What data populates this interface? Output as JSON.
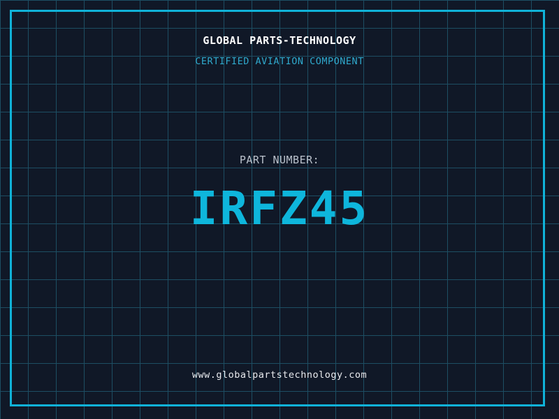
{
  "placard": {
    "company_name": "GLOBAL PARTS-TECHNOLOGY",
    "certification": "CERTIFIED AVIATION COMPONENT",
    "part_label": "PART NUMBER:",
    "part_number": "IRFZ45",
    "website": "www.globalpartstechnology.com"
  },
  "colors": {
    "background": "#101827",
    "grid_line": "#1d4e63",
    "frame": "#10b2d8",
    "title": "#ffffff",
    "subtitle": "#2fa9cd",
    "label": "#bac1cb",
    "part_number": "#0eb6dc",
    "website": "#e8eaee"
  }
}
